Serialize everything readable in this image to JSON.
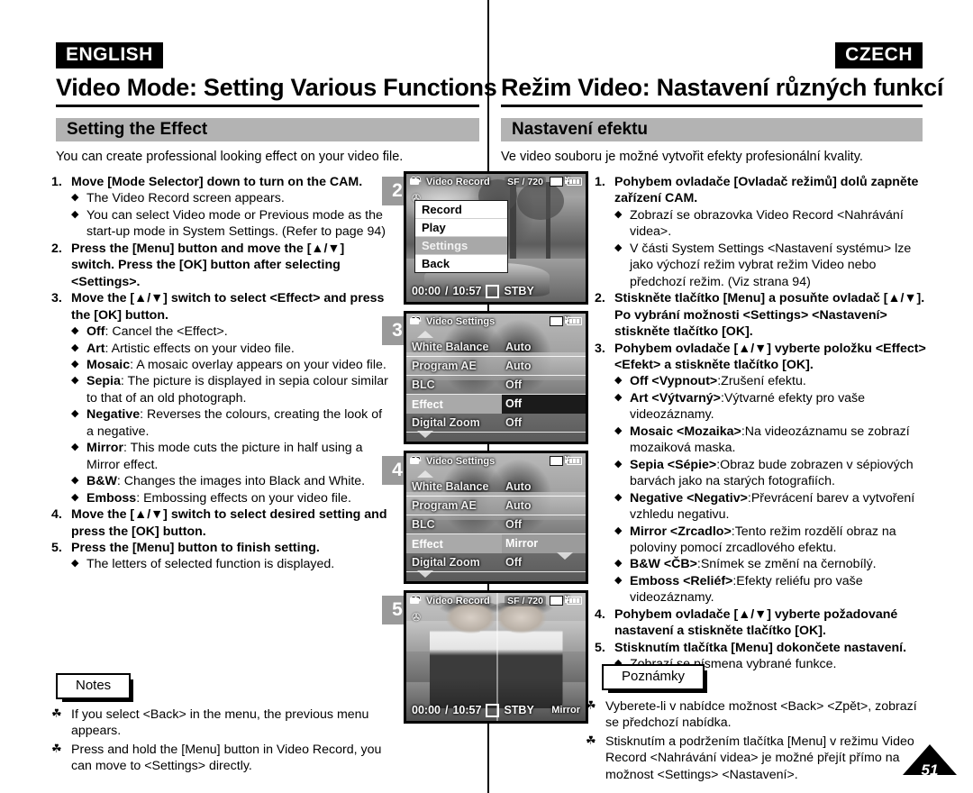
{
  "header": {
    "left_lang": "ENGLISH",
    "right_lang": "CZECH",
    "left_title": "Video Mode: Setting Various Functions",
    "right_title": "Režim Video: Nastavení různých funkcí"
  },
  "section": {
    "left_bar": "Setting the Effect",
    "right_bar": "Nastavení efektu",
    "left_intro": "You can create professional looking effect on your video file.",
    "right_intro": "Ve video souboru je možné vytvořit efekty profesionální kvality."
  },
  "english": {
    "steps": [
      {
        "num": "1.",
        "text": "Move [Mode Selector] down to turn on the CAM.",
        "subs": [
          {
            "bold": "",
            "text": "The Video Record screen appears."
          },
          {
            "bold": "",
            "text": "You can select Video mode or Previous mode as the start-up mode in System Settings. (Refer to page 94)"
          }
        ]
      },
      {
        "num": "2.",
        "text": "Press the [Menu] button and move the [▲/▼] switch. Press the [OK] button after selecting <Settings>.",
        "subs": []
      },
      {
        "num": "3.",
        "text": "Move the [▲/▼] switch to select <Effect> and press the [OK] button.",
        "subs": [
          {
            "bold": "Off",
            "text": ": Cancel the <Effect>."
          },
          {
            "bold": "Art",
            "text": ": Artistic effects on your video file."
          },
          {
            "bold": "Mosaic",
            "text": ": A mosaic overlay appears on your video file."
          },
          {
            "bold": "Sepia",
            "text": ": The picture is displayed in sepia colour similar to that of an old photograph."
          },
          {
            "bold": "Negative",
            "text": ": Reverses the colours, creating the look of a negative."
          },
          {
            "bold": "Mirror",
            "text": ": This mode cuts the picture in half using a Mirror effect."
          },
          {
            "bold": "B&W",
            "text": ": Changes the images into Black and White."
          },
          {
            "bold": "Emboss",
            "text": ": Embossing effects on your video file."
          }
        ]
      },
      {
        "num": "4.",
        "text": "Move the [▲/▼] switch to select desired setting and press the [OK] button.",
        "subs": []
      },
      {
        "num": "5.",
        "text": "Press the [Menu] button to finish setting.",
        "subs": [
          {
            "bold": "",
            "text": "The letters of selected function is displayed."
          }
        ]
      }
    ],
    "notes_label": "Notes",
    "notes": [
      "If you select <Back> in the menu, the previous menu appears.",
      "Press and hold the [Menu] button in Video Record, you can move to <Settings> directly."
    ]
  },
  "czech": {
    "steps": [
      {
        "num": "1.",
        "text": "Pohybem ovladače [Ovladač režimů] dolů zapněte zařízení CAM.",
        "subs": [
          {
            "bold": "",
            "text": "Zobrazí se obrazovka Video Record <Nahrávání videa>."
          },
          {
            "bold": "",
            "text": "V části System Settings <Nastavení systému> lze jako výchozí režim vybrat režim Video nebo předchozí režim. (Viz strana 94)"
          }
        ]
      },
      {
        "num": "2.",
        "text": "Stiskněte tlačítko [Menu] a posuňte ovladač [▲/▼]. Po vybrání možnosti <Settings> <Nastavení> stiskněte tlačítko [OK].",
        "subs": []
      },
      {
        "num": "3.",
        "text": "Pohybem ovladače [▲/▼] vyberte položku <Effect> <Efekt> a stiskněte tlačítko [OK].",
        "subs": [
          {
            "bold": "Off <Vypnout>",
            "text": ":Zrušení efektu."
          },
          {
            "bold": "Art <Výtvarný>",
            "text": ":Výtvarné efekty pro vaše videozáznamy."
          },
          {
            "bold": "Mosaic <Mozaika>",
            "text": ":Na videozáznamu se zobrazí mozaiková maska."
          },
          {
            "bold": "Sepia <Sépie>",
            "text": ":Obraz bude zobrazen v sépiových barvách jako na starých fotografiích."
          },
          {
            "bold": "Negative <Negativ>",
            "text": ":Převrácení barev a vytvoření vzhledu negativu."
          },
          {
            "bold": "Mirror <Zrcadlo>",
            "text": ":Tento režim rozdělí obraz na poloviny pomocí zrcadlového efektu."
          },
          {
            "bold": "B&W <ČB>",
            "text": ":Snímek se změní na černobílý."
          },
          {
            "bold": "Emboss <Reliéf>",
            "text": ":Efekty reliéfu pro vaše videozáznamy."
          }
        ]
      },
      {
        "num": "4.",
        "text": "Pohybem ovladače [▲/▼] vyberte požadované nastavení a stiskněte tlačítko [OK].",
        "subs": []
      },
      {
        "num": "5.",
        "text": "Stisknutím tlačítka [Menu] dokončete nastavení.",
        "subs": [
          {
            "bold": "",
            "text": "Zobrazí se písmena vybrané funkce."
          }
        ]
      }
    ],
    "notes_label": "Poznámky",
    "notes": [
      "Vyberete-li v nabídce možnost <Back> <Zpět>, zobrazí se předchozí nabídka.",
      "Stisknutím a podržením tlačítka [Menu] v režimu Video Record <Nahrávání videa> je možné přejít přímo na možnost <Settings> <Nastavení>."
    ]
  },
  "screens": [
    {
      "step": "2",
      "osd_title": "Video Record",
      "quality": "SF",
      "separator": "/",
      "resolution": "720",
      "card_label": "N",
      "time_elapsed": "00:00",
      "time_sep": "/",
      "time_remaining": "10:57",
      "status": "STBY",
      "effect_label": "",
      "menu": [
        {
          "label": "Record",
          "selected": false
        },
        {
          "label": "Play",
          "selected": false
        },
        {
          "label": "Settings",
          "selected": true
        },
        {
          "label": "Back",
          "selected": false
        }
      ]
    },
    {
      "step": "3",
      "osd_title": "Video Settings",
      "card_label": "N",
      "rows": [
        {
          "label": "White Balance",
          "value": "Auto",
          "highlight": false
        },
        {
          "label": "Program AE",
          "value": "Auto",
          "highlight": false
        },
        {
          "label": "BLC",
          "value": "Off",
          "highlight": false
        },
        {
          "label": "Effect",
          "value": "Off",
          "highlight": true
        },
        {
          "label": "Digital Zoom",
          "value": "Off",
          "highlight": false
        }
      ]
    },
    {
      "step": "4",
      "osd_title": "Video Settings",
      "card_label": "N",
      "rows": [
        {
          "label": "White Balance",
          "value": "Auto",
          "highlight": false
        },
        {
          "label": "Program AE",
          "value": "Auto",
          "highlight": false
        },
        {
          "label": "BLC",
          "value": "Off",
          "highlight": false
        },
        {
          "label": "Effect",
          "value": "Mirror",
          "highlight": true
        },
        {
          "label": "Digital Zoom",
          "value": "Off",
          "highlight": false
        }
      ]
    },
    {
      "step": "5",
      "osd_title": "Video Record",
      "quality": "SF",
      "separator": "/",
      "resolution": "720",
      "card_label": "N",
      "time_elapsed": "00:00",
      "time_sep": "/",
      "time_remaining": "10:57",
      "status": "STBY",
      "effect_label": "Mirror"
    }
  ],
  "page_number": "51",
  "colors": {
    "section_bar": "#b3b3b3",
    "step_badge": "#9a9a9a",
    "lang_tag_bg": "#000000"
  }
}
